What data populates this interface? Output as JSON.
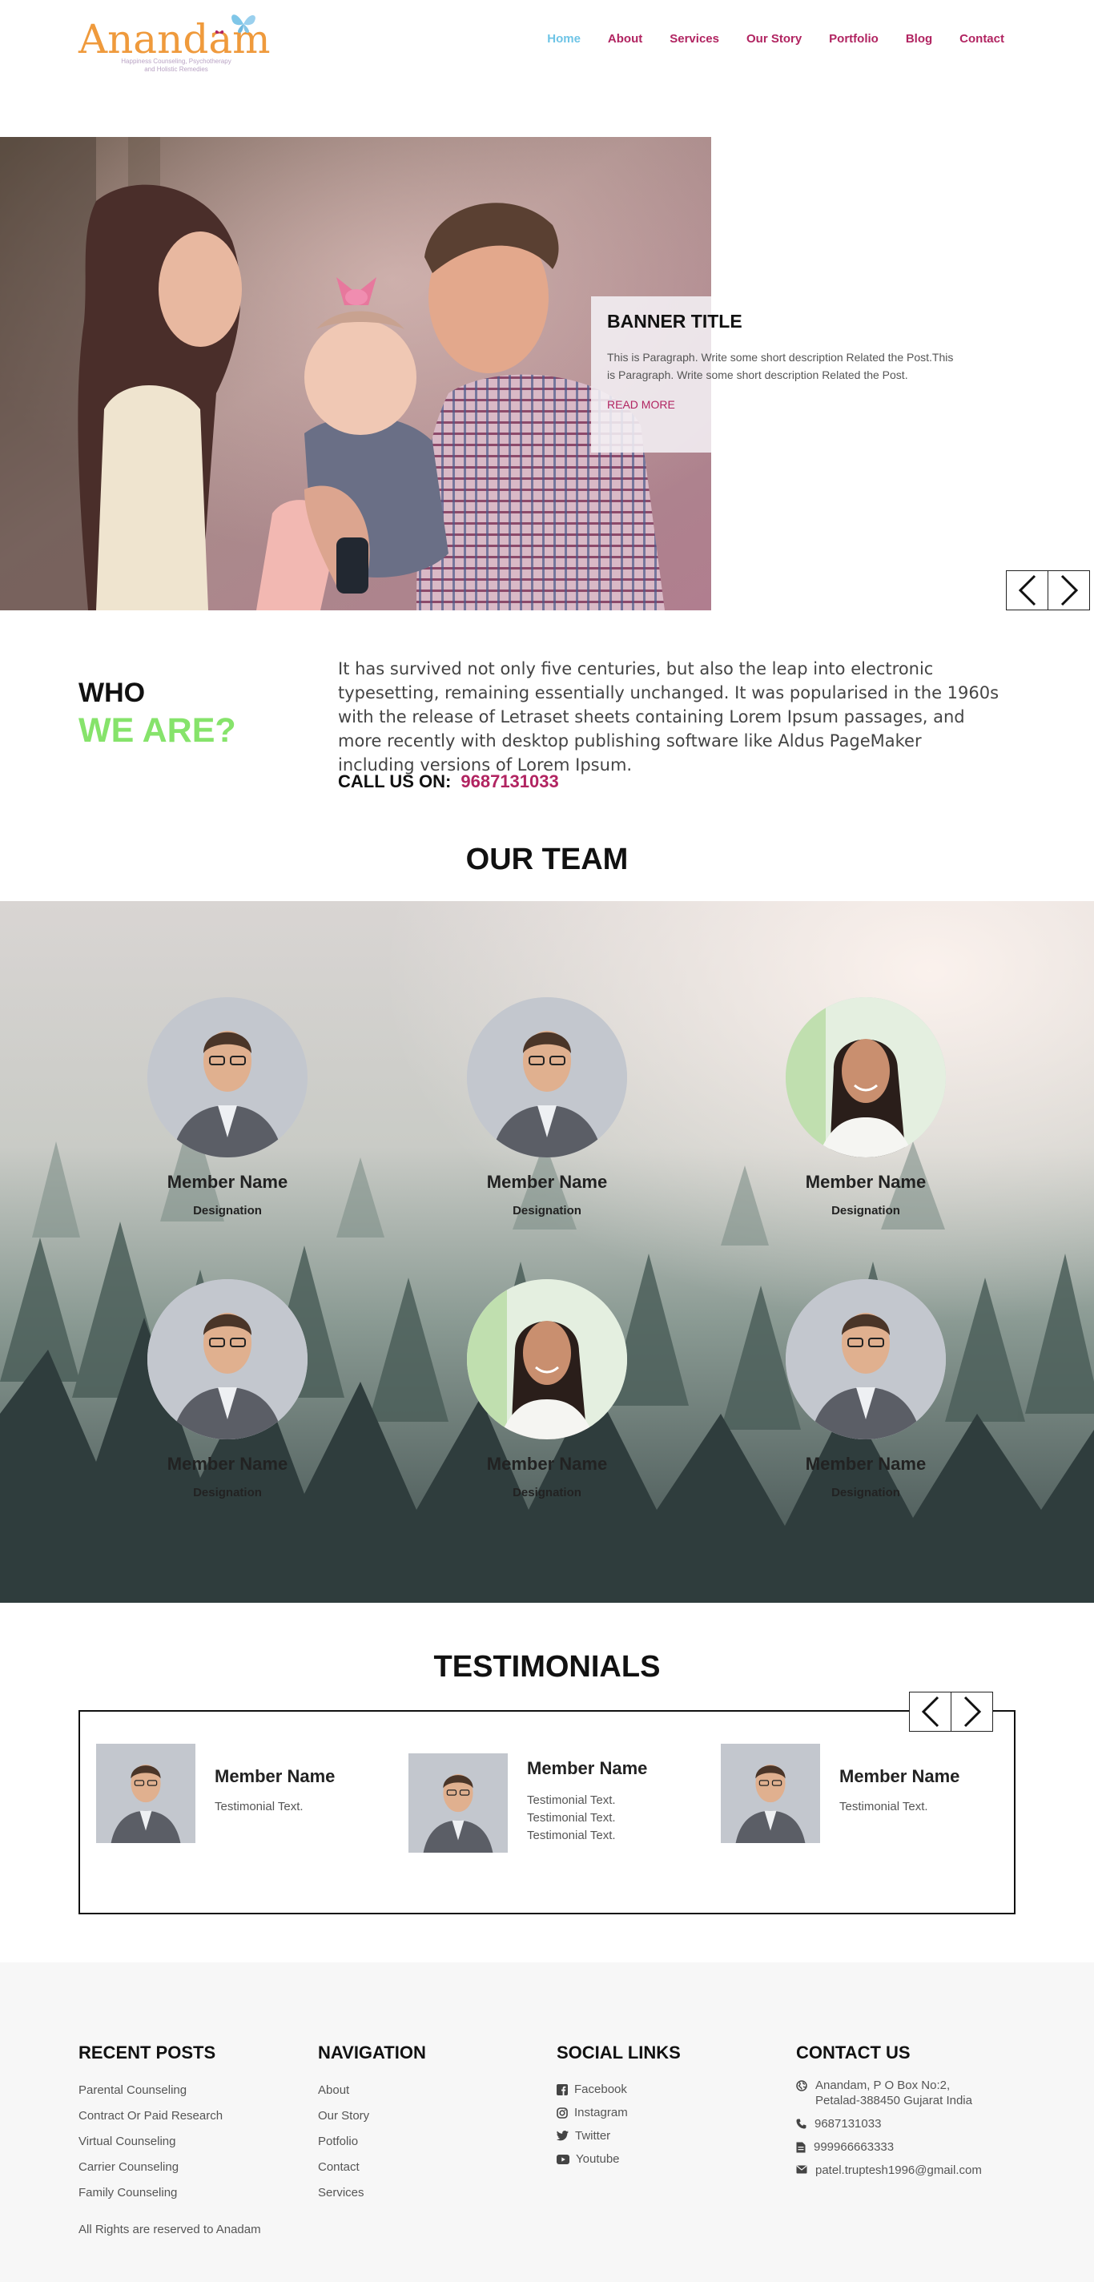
{
  "brand": {
    "name": "Anandam",
    "tagline_1": "Happiness Counseling, Psychotherapy",
    "tagline_2": "and Holistic Remedies"
  },
  "nav": {
    "items": [
      "Home",
      "About",
      "Services",
      "Our Story",
      "Portfolio",
      "Blog",
      "Contact"
    ],
    "active": "Home"
  },
  "banner": {
    "title": "BANNER TITLE",
    "description": "This is Paragraph. Write some short description Related the Post.This is Paragraph. Write some short description Related the Post.",
    "read_more": "READ MORE"
  },
  "who": {
    "line1": "WHO",
    "line2": "WE ARE?",
    "body": "It has survived not only five centuries, but also the leap into electronic typesetting, remaining essentially unchanged. It was popularised in the 1960s with the release of Letraset sheets containing Lorem Ipsum passages, and more recently with desktop publishing software like Aldus PageMaker including versions of Lorem Ipsum.",
    "call_label": "CALL US ON:",
    "call_number": "9687131033"
  },
  "team": {
    "title": "OUR TEAM",
    "members": [
      {
        "name": "Member Name",
        "designation": "Designation",
        "photo": "man"
      },
      {
        "name": "Member Name",
        "designation": "Designation",
        "photo": "man"
      },
      {
        "name": "Member Name",
        "designation": "Designation",
        "photo": "woman"
      },
      {
        "name": "Member Name",
        "designation": "Designation",
        "photo": "man"
      },
      {
        "name": "Member Name",
        "designation": "Designation",
        "photo": "woman"
      },
      {
        "name": "Member Name",
        "designation": "Designation",
        "photo": "man"
      }
    ]
  },
  "testimonials": {
    "title": "TESTIMONIALS",
    "items": [
      {
        "name": "Member Name",
        "text": "Testimonial Text."
      },
      {
        "name": "Member Name",
        "text": "Testimonial Text. Testimonial Text. Testimonial Text."
      },
      {
        "name": "Member Name",
        "text": "Testimonial Text."
      }
    ]
  },
  "footer": {
    "recent_posts": {
      "title": "RECENT POSTS",
      "items": [
        "Parental Counseling",
        "Contract Or Paid Research",
        "Virtual Counseling",
        "Carrier Counseling",
        "Family Counseling"
      ]
    },
    "navigation": {
      "title": "NAVIGATION",
      "items": [
        "About",
        "Our Story",
        "Potfolio",
        "Contact",
        "Services"
      ]
    },
    "social": {
      "title": "SOCIAL LINKS",
      "items": [
        {
          "label": "Facebook",
          "icon": "facebook-icon"
        },
        {
          "label": "Instagram",
          "icon": "instagram-icon"
        },
        {
          "label": "Twitter",
          "icon": "twitter-icon"
        },
        {
          "label": "Youtube",
          "icon": "youtube-icon"
        }
      ]
    },
    "contact": {
      "title": "CONTACT US",
      "address": "Anandam, P O Box No:2, Petalad-388450 Gujarat India",
      "phone": "9687131033",
      "fax": "999966663333",
      "email": "patel.truptesh1996@gmail.com"
    },
    "copyright": "All Rights are reserved to Anadam"
  },
  "colors": {
    "accent": "#b12461",
    "nav_active": "#6ec4e6",
    "logo": "#ef9a3c",
    "highlight_green": "#86e36b",
    "footer_bg": "#f7f7f7"
  }
}
